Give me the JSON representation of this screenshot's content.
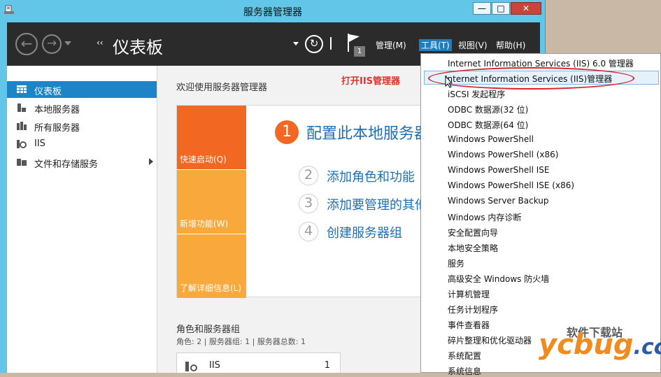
{
  "window": {
    "title": "服务器管理器",
    "controls": [
      "—",
      "□",
      "✕"
    ]
  },
  "header": {
    "breadcrumb_chevron": "‹‹",
    "title": "仪表板",
    "flag_badge": "1",
    "menus": [
      "管理(M)",
      "工具(T)",
      "视图(V)",
      "帮助(H)"
    ]
  },
  "sidebar": {
    "items": [
      {
        "label": "仪表板",
        "icon": "dashboard-icon"
      },
      {
        "label": "本地服务器",
        "icon": "server-icon"
      },
      {
        "label": "所有服务器",
        "icon": "servers-icon"
      },
      {
        "label": "IIS",
        "icon": "iis-icon"
      },
      {
        "label": "文件和存储服务",
        "icon": "storage-icon"
      }
    ]
  },
  "main": {
    "welcome": "欢迎使用服务器管理器",
    "annotation": "打开IIS管理器",
    "tiles": [
      "快速启动(Q)",
      "新增功能(W)",
      "了解详细信息(L)"
    ],
    "steps": [
      {
        "num": "1",
        "label": "配置此本地服务器"
      },
      {
        "num": "2",
        "label": "添加角色和功能"
      },
      {
        "num": "3",
        "label": "添加要管理的其他服务器"
      },
      {
        "num": "4",
        "label": "创建服务器组"
      }
    ],
    "roles_title": "角色和服务器组",
    "roles_sub": "角色: 2 | 服务器组: 1 | 服务器总数: 1",
    "iis_card": {
      "name": "IIS",
      "count": "1"
    }
  },
  "tools_menu": [
    "Internet Information Services (IIS) 6.0 管理器",
    "Internet Information Services (IIS)管理器",
    "iSCSI 发起程序",
    "ODBC 数据源(32 位)",
    "ODBC 数据源(64 位)",
    "Windows PowerShell",
    "Windows PowerShell (x86)",
    "Windows PowerShell ISE",
    "Windows PowerShell ISE (x86)",
    "Windows Server Backup",
    "Windows 内存诊断",
    "安全配置向导",
    "本地安全策略",
    "服务",
    "高级安全 Windows 防火墙",
    "计算机管理",
    "任务计划程序",
    "事件查看器",
    "碎片整理和优化驱动器",
    "系统配置",
    "系统信息"
  ],
  "watermark": {
    "top": "软件下载站",
    "brand_yc": "yc",
    "brand_bug": "bug",
    "brand_cc": ".cc"
  },
  "colors": {
    "accent": "#1e84c8",
    "tile_orange": "#f26722",
    "tile_amber": "#f9a93b",
    "annotation": "#e0322f"
  }
}
